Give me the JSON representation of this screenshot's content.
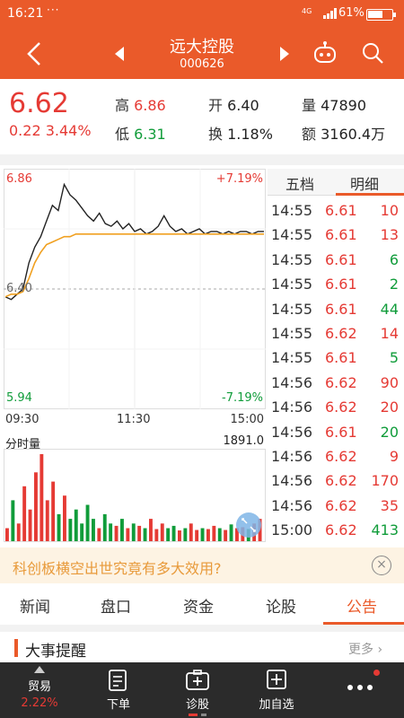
{
  "status_bar": {
    "time": "16:21",
    "dots": "···",
    "network": "4G",
    "battery": "61%"
  },
  "header": {
    "title": "远大控股",
    "code": "000626"
  },
  "quote": {
    "price": "6.62",
    "change": "0.22",
    "change_pct": "3.44%",
    "high_label": "高",
    "high": "6.86",
    "low_label": "低",
    "low": "6.31",
    "open_label": "开",
    "open": "6.40",
    "turnover_label": "换",
    "turnover": "1.18%",
    "volume_label": "量",
    "volume": "47890",
    "amount_label": "额",
    "amount": "3160.4万"
  },
  "intraday": {
    "top_price": "6.86",
    "top_pct": "+7.19%",
    "mid_price": "6.40",
    "bottom_price": "5.94",
    "bottom_pct": "-7.19%",
    "x_labels": [
      "09:30",
      "11:30",
      "15:00"
    ],
    "volume_label": "分时量",
    "volume_max": "1891.0"
  },
  "chart_data": {
    "type": "line",
    "title": "",
    "ylim": [
      5.94,
      6.86
    ],
    "series": [
      {
        "name": "",
        "values": [
          6.37,
          6.36,
          6.38,
          6.4,
          6.5,
          6.56,
          6.6,
          6.66,
          6.72,
          6.7,
          6.8,
          6.76,
          6.74,
          6.71,
          6.68,
          6.66,
          6.69,
          6.65,
          6.64,
          6.66,
          6.63,
          6.65,
          6.62,
          6.63,
          6.61,
          6.62,
          6.64,
          6.68,
          6.64,
          6.62,
          6.63,
          6.61,
          6.62,
          6.63,
          6.61,
          6.62,
          6.62,
          6.61,
          6.62,
          6.61,
          6.62,
          6.62,
          6.61,
          6.62,
          6.62
        ]
      },
      {
        "name": "",
        "values": [
          6.37,
          6.38,
          6.38,
          6.39,
          6.44,
          6.5,
          6.54,
          6.57,
          6.58,
          6.59,
          6.6,
          6.6,
          6.61,
          6.61,
          6.61,
          6.61,
          6.61,
          6.61,
          6.61,
          6.61,
          6.61,
          6.61,
          6.61,
          6.61,
          6.61,
          6.61,
          6.61,
          6.61,
          6.61,
          6.61,
          6.61,
          6.61,
          6.61,
          6.61,
          6.61,
          6.61,
          6.61,
          6.61,
          6.61,
          6.61,
          6.61,
          6.61,
          6.61,
          6.61,
          6.61
        ]
      }
    ],
    "volume": [
      300,
      900,
      400,
      1200,
      700,
      1500,
      1891,
      900,
      1300,
      600,
      1000,
      500,
      700,
      400,
      800,
      500,
      300,
      600,
      400,
      350,
      500,
      300,
      400,
      350,
      300,
      500,
      280,
      400,
      300,
      350,
      250,
      300,
      400,
      260,
      300,
      280,
      350,
      300,
      260,
      380,
      300,
      320,
      280,
      400,
      500
    ]
  },
  "trades": {
    "tab_five": "五档",
    "tab_detail": "明细",
    "rows": [
      {
        "time": "14:55",
        "price": "6.61",
        "vol": "10",
        "pc": "red",
        "vc": "red"
      },
      {
        "time": "14:55",
        "price": "6.61",
        "vol": "13",
        "pc": "red",
        "vc": "red"
      },
      {
        "time": "14:55",
        "price": "6.61",
        "vol": "6",
        "pc": "red",
        "vc": "green"
      },
      {
        "time": "14:55",
        "price": "6.61",
        "vol": "2",
        "pc": "red",
        "vc": "green"
      },
      {
        "time": "14:55",
        "price": "6.61",
        "vol": "44",
        "pc": "red",
        "vc": "green"
      },
      {
        "time": "14:55",
        "price": "6.62",
        "vol": "14",
        "pc": "red",
        "vc": "red"
      },
      {
        "time": "14:55",
        "price": "6.61",
        "vol": "5",
        "pc": "red",
        "vc": "green"
      },
      {
        "time": "14:56",
        "price": "6.62",
        "vol": "90",
        "pc": "red",
        "vc": "red"
      },
      {
        "time": "14:56",
        "price": "6.62",
        "vol": "20",
        "pc": "red",
        "vc": "red"
      },
      {
        "time": "14:56",
        "price": "6.61",
        "vol": "20",
        "pc": "red",
        "vc": "green"
      },
      {
        "time": "14:56",
        "price": "6.62",
        "vol": "9",
        "pc": "red",
        "vc": "red"
      },
      {
        "time": "14:56",
        "price": "6.62",
        "vol": "170",
        "pc": "red",
        "vc": "red"
      },
      {
        "time": "14:56",
        "price": "6.62",
        "vol": "35",
        "pc": "red",
        "vc": "red"
      },
      {
        "time": "15:00",
        "price": "6.62",
        "vol": "413",
        "pc": "red",
        "vc": "green"
      }
    ]
  },
  "ad": {
    "text": "科创板横空出世究竟有多大效用?",
    "close": "×"
  },
  "news_tabs": [
    "新闻",
    "盘口",
    "资金",
    "论股",
    "公告"
  ],
  "section": {
    "title": "大事提醒",
    "more": "更多 ›"
  },
  "nav": {
    "trade": "贸易",
    "trade_pct": "2.22%",
    "order": "下单",
    "diagnose": "诊股",
    "add_fav": "加自选"
  },
  "colors": {
    "brand": "#ea5a2a",
    "up": "#e53a34",
    "down": "#109c3a",
    "avg_line": "#f0a020"
  }
}
